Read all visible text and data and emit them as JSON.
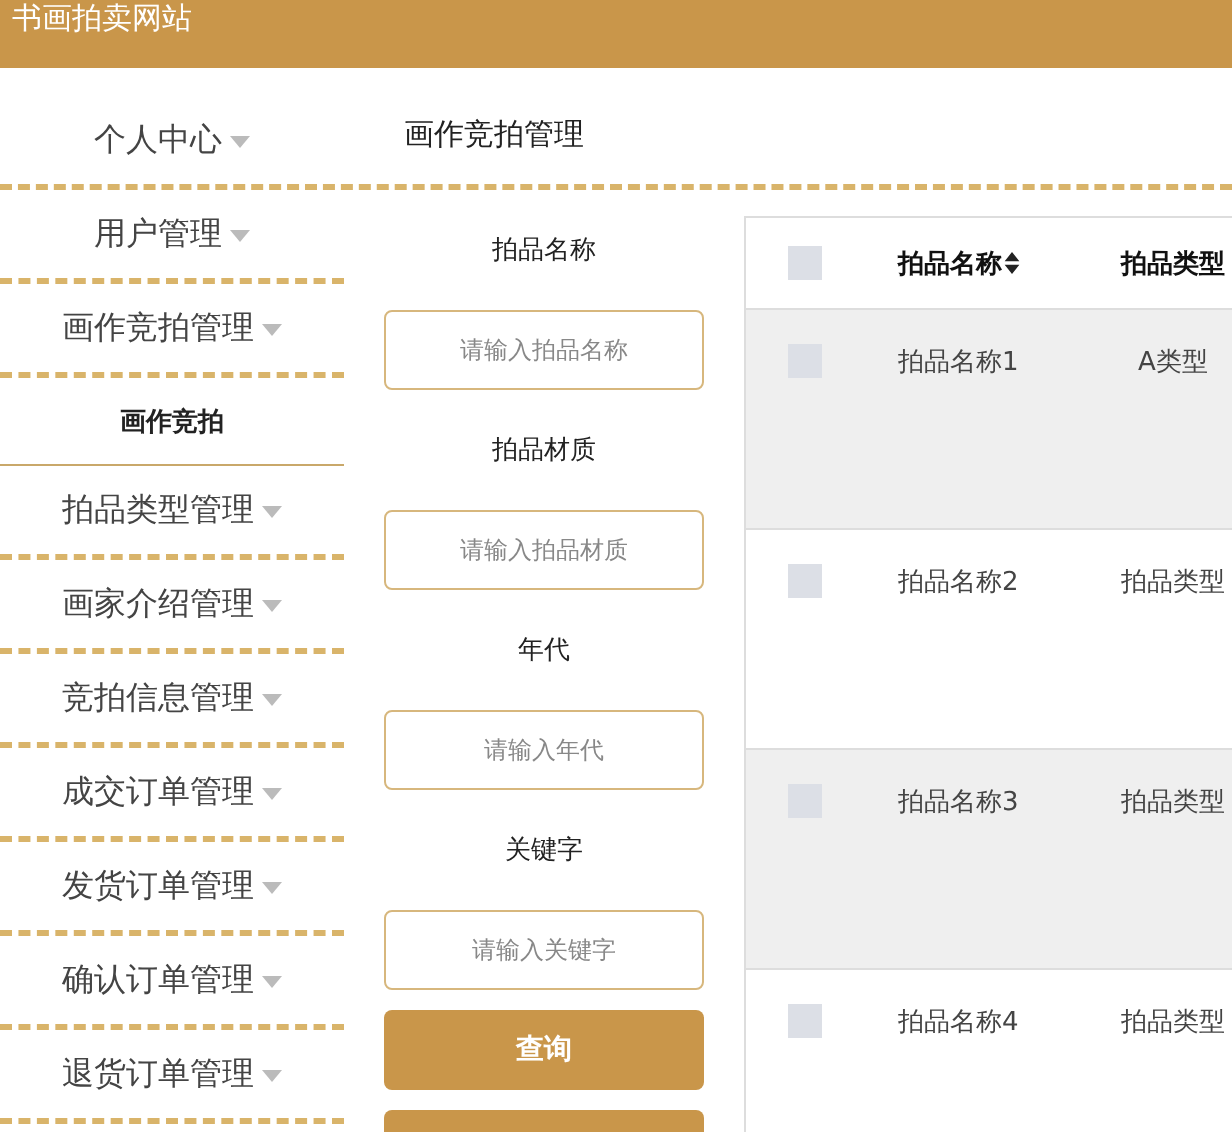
{
  "header": {
    "title": "书画拍卖网站"
  },
  "page_title": "画作竞拍管理",
  "sidebar": {
    "items": [
      {
        "label": "个人中心",
        "kind": "menu"
      },
      {
        "label": "用户管理",
        "kind": "menu"
      },
      {
        "label": "画作竞拍管理",
        "kind": "menu"
      },
      {
        "label": "画作竞拍",
        "kind": "submenu"
      },
      {
        "label": "拍品类型管理",
        "kind": "menu"
      },
      {
        "label": "画家介绍管理",
        "kind": "menu"
      },
      {
        "label": "竞拍信息管理",
        "kind": "menu"
      },
      {
        "label": "成交订单管理",
        "kind": "menu"
      },
      {
        "label": "发货订单管理",
        "kind": "menu"
      },
      {
        "label": "确认订单管理",
        "kind": "menu"
      },
      {
        "label": "退货订单管理",
        "kind": "menu"
      }
    ]
  },
  "filters": [
    {
      "label": "拍品名称",
      "placeholder": "请输入拍品名称"
    },
    {
      "label": "拍品材质",
      "placeholder": "请输入拍品材质"
    },
    {
      "label": "年代",
      "placeholder": "请输入年代"
    },
    {
      "label": "关键字",
      "placeholder": "请输入关键字"
    }
  ],
  "search_button": "查询",
  "table": {
    "select_all": {
      "checked": false
    },
    "columns": [
      "拍品名称",
      "拍品类型"
    ],
    "rows": [
      {
        "checked": false,
        "cells": [
          "拍品名称1",
          "A类型"
        ]
      },
      {
        "checked": false,
        "cells": [
          "拍品名称2",
          "拍品类型"
        ]
      },
      {
        "checked": false,
        "cells": [
          "拍品名称3",
          "拍品类型"
        ]
      },
      {
        "checked": false,
        "cells": [
          "拍品名称4",
          "拍品类型"
        ]
      }
    ]
  }
}
